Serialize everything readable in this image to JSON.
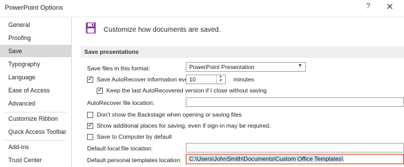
{
  "window": {
    "title": "PowerPoint Options",
    "help_glyph": "?",
    "close_glyph": "✕"
  },
  "sidebar": {
    "items": [
      {
        "label": "General"
      },
      {
        "label": "Proofing"
      },
      {
        "label": "Save",
        "active": true
      },
      {
        "label": "Typography"
      },
      {
        "label": "Language"
      },
      {
        "label": "Ease of Access"
      },
      {
        "label": "Advanced"
      },
      {
        "label": "Customize Ribbon"
      },
      {
        "label": "Quick Access Toolbar"
      },
      {
        "label": "Add-ins"
      },
      {
        "label": "Trust Center"
      }
    ]
  },
  "header": {
    "text": "Customize how documents are saved.",
    "icon": "floppy-disk-icon",
    "accent": "#7c2d9b"
  },
  "section": {
    "title": "Save presentations"
  },
  "save_format": {
    "label": "Save files in this format:",
    "value": "PowerPoint Presentation"
  },
  "autorecover": {
    "label": "Save AutoRecover information every",
    "checked": true,
    "minutes_value": "10",
    "minutes_label": "minutes"
  },
  "keep_last": {
    "label": "Keep the last AutoRecovered version if I close without saving",
    "checked": true
  },
  "autorecover_location": {
    "label": "AutoRecover file location:",
    "value": ""
  },
  "backstage": {
    "label": "Don't show the Backstage when opening or saving files",
    "checked": false
  },
  "additional_places": {
    "label": "Show additional places for saving, even if sign-in may be required.",
    "checked": true
  },
  "save_to_computer": {
    "label": "Save to Computer by default",
    "checked": false
  },
  "default_local": {
    "label": "Default local file location:",
    "value": ""
  },
  "personal_templates": {
    "label": "Default personal templates location:",
    "value": "C:\\Users\\JohnSmith\\Documents\\Custom Office Templates\\"
  },
  "colors": {
    "active_nav": "#d9d9d9",
    "highlight_border": "#d84315",
    "selection": "#cce4f7"
  }
}
